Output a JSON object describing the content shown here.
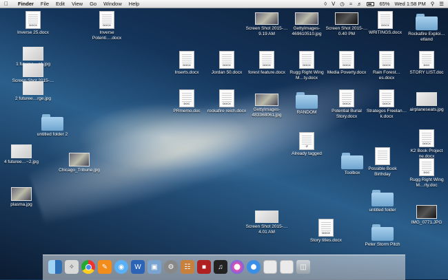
{
  "menubar": {
    "app": "Finder",
    "menus": [
      "File",
      "Edit",
      "View",
      "Go",
      "Window",
      "Help"
    ],
    "battery": "65%",
    "clock": "Wed 1:58 PM",
    "status_icons": [
      "dropbox-icon",
      "bluetooth-icon",
      "time-machine-icon",
      "wifi-icon",
      "volume-icon",
      "battery-icon",
      "search-icon",
      "list-icon"
    ]
  },
  "desktop": {
    "items": [
      {
        "name": "Inverse 25.docx",
        "kind": "doc"
      },
      {
        "name": "1 futuree…e1.jpg",
        "kind": "img"
      },
      {
        "name": "Screen Shot 2015-…01 AM",
        "kind": "img"
      },
      {
        "name": "2 futuree…rge.jpg",
        "kind": "img"
      },
      {
        "name": "untitled folder 2",
        "kind": "folder"
      },
      {
        "name": "4 futuree…~2.jpg",
        "kind": "img"
      },
      {
        "name": "plasma.jpg",
        "kind": "img"
      },
      {
        "name": "Inverse Potenti….docx",
        "kind": "doc"
      },
      {
        "name": "Chicago_Tribune.jpg",
        "kind": "img"
      },
      {
        "name": "Screen Shot 2015-…9.19 AM",
        "kind": "img"
      },
      {
        "name": "GettyImages-469610510.jpg",
        "kind": "img"
      },
      {
        "name": "Screen Shot 2015-…0.40 PM",
        "kind": "img"
      },
      {
        "name": "WRITINGS.docx",
        "kind": "doc"
      },
      {
        "name": "Rockafire Exploi…etland",
        "kind": "folder"
      },
      {
        "name": "Inserts.docx",
        "kind": "doc"
      },
      {
        "name": "Jordan 50.docx",
        "kind": "doc"
      },
      {
        "name": "forest feature.docx",
        "kind": "doc"
      },
      {
        "name": "Rugg Right Wing M…ty.docx",
        "kind": "doc"
      },
      {
        "name": "Media Poverty.docx",
        "kind": "doc"
      },
      {
        "name": "Rain Forest…es.docx",
        "kind": "doc"
      },
      {
        "name": "STORY LIST.doc",
        "kind": "doc"
      },
      {
        "name": "PRmemo.doc",
        "kind": "doc"
      },
      {
        "name": "rockafire reich.docx",
        "kind": "doc"
      },
      {
        "name": "GettyImages-483368061.jpg",
        "kind": "img"
      },
      {
        "name": "RANDOM",
        "kind": "folder"
      },
      {
        "name": "Potential Burial Story.docx",
        "kind": "doc"
      },
      {
        "name": "Strategos Freelan…k.docx",
        "kind": "doc"
      },
      {
        "name": "airplaneseats.jpg",
        "kind": "img"
      },
      {
        "name": "Already tagged",
        "kind": "alias"
      },
      {
        "name": "K2 Book Project ne.docx",
        "kind": "doc"
      },
      {
        "name": "Toolbox",
        "kind": "folder"
      },
      {
        "name": "Possible Book Birthday",
        "kind": "doc"
      },
      {
        "name": "Rugg Right Wing M…rty.doc",
        "kind": "doc"
      },
      {
        "name": "untitled folder",
        "kind": "folder"
      },
      {
        "name": "IMG_0771.JPG",
        "kind": "img"
      },
      {
        "name": "Screen Shot 2015-…4.01 AM",
        "kind": "img"
      },
      {
        "name": "Story titles.docx",
        "kind": "doc"
      },
      {
        "name": "Peter Storm Pitch",
        "kind": "folder"
      }
    ]
  },
  "dock": {
    "items": [
      {
        "name": "Finder",
        "icon": "finder-icon"
      },
      {
        "name": "Launchpad",
        "icon": "launchpad-icon"
      },
      {
        "name": "Google Chrome",
        "icon": "chrome-icon"
      },
      {
        "name": "Pages",
        "icon": "pages-icon"
      },
      {
        "name": "Messages",
        "icon": "messages-icon"
      },
      {
        "name": "Microsoft Word",
        "icon": "word-icon"
      },
      {
        "name": "Preview",
        "icon": "preview-icon"
      },
      {
        "name": "System Preferences",
        "icon": "system-preferences-icon"
      },
      {
        "name": "iBooks",
        "icon": "books-icon"
      },
      {
        "name": "Photo Booth",
        "icon": "photo-booth-icon"
      },
      {
        "name": "Music",
        "icon": "music-icon"
      },
      {
        "name": "iTunes",
        "icon": "itunes-icon"
      },
      {
        "name": "Safari",
        "icon": "safari-icon"
      },
      {
        "name": "Downloads stack",
        "icon": "downloads-stack-icon"
      },
      {
        "name": "Documents stack",
        "icon": "documents-stack-icon"
      },
      {
        "name": "Trash",
        "icon": "trash-icon"
      }
    ]
  }
}
